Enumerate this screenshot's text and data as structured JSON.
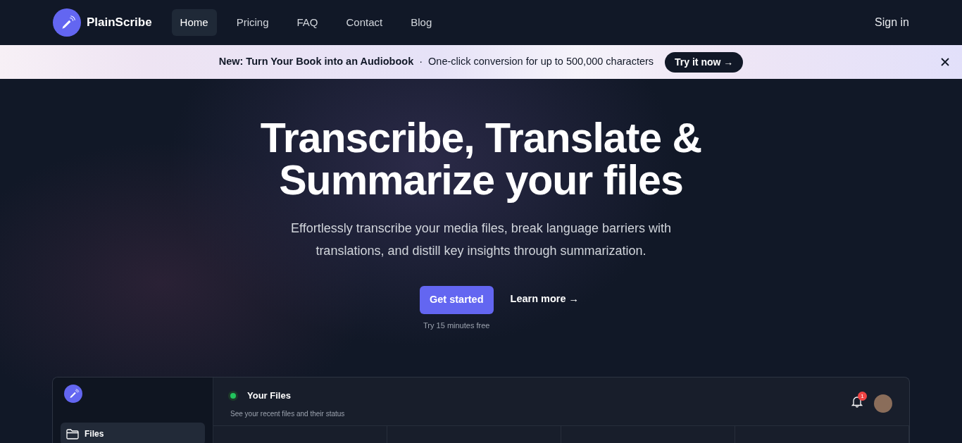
{
  "brand": {
    "name": "PlainScribe"
  },
  "nav": {
    "links": [
      {
        "label": "Home",
        "selected": true
      },
      {
        "label": "Pricing",
        "selected": false
      },
      {
        "label": "FAQ",
        "selected": false
      },
      {
        "label": "Contact",
        "selected": false
      },
      {
        "label": "Blog",
        "selected": false
      }
    ],
    "sign_in": "Sign in"
  },
  "banner": {
    "title": "New: Turn Your Book into an Audiobook",
    "separator": "·",
    "text": "One-click conversion for up to 500,000 characters",
    "cta": "Try it now →"
  },
  "hero": {
    "title": "Transcribe, Translate & Summarize your files",
    "subtitle": "Effortlessly transcribe your media files, break language barriers with translations, and distill key insights through summarization.",
    "primary": "Get started",
    "secondary": "Learn more →",
    "note": "Try 15 minutes free"
  },
  "app_preview": {
    "title": "Your Files",
    "subtitle": "See your recent files and their status",
    "notification_count": "1",
    "sidebar": {
      "items": [
        {
          "label": "Files",
          "selected": true
        }
      ]
    }
  }
}
